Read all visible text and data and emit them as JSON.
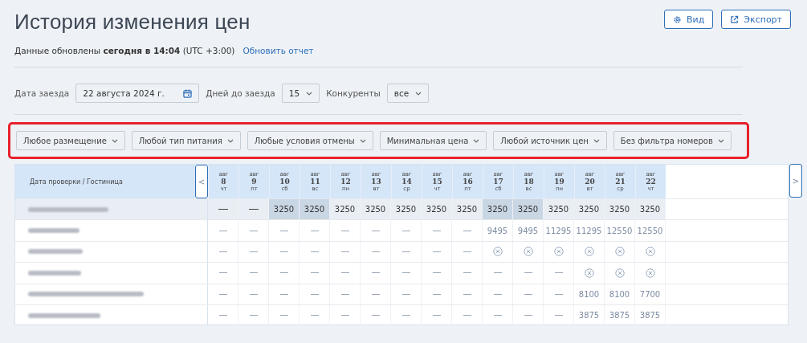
{
  "header": {
    "title": "История изменения цен",
    "buttons": [
      {
        "label": "Вид",
        "kind": "view"
      },
      {
        "label": "Экспорт",
        "kind": "export"
      }
    ]
  },
  "update_info": {
    "text": "Данные обновлены **сегодня в 14:04** (UTC +3:00)",
    "link": "Обновить отчет"
  },
  "controls": {
    "checkin": {
      "label": "Дата заезда",
      "value": "22 августа 2024 г."
    },
    "days": {
      "label": "Дней до заезда",
      "value": "15"
    },
    "competitors": {
      "label": "Конкуренты",
      "value": "все"
    }
  },
  "filters": {
    "highlighted": true,
    "items": [
      "Любое размещение",
      "Любой тип питания",
      "Любые условия отмены",
      "Минимальная цена",
      "Любой источник цен",
      "Без фильтра номеров"
    ]
  },
  "table": {
    "name_header": "Дата проверки / Гостиница",
    "prev": "<",
    "next": ">",
    "columns": [
      {
        "month": "авг",
        "day": "8",
        "weekday": "чт",
        "weekend": false
      },
      {
        "month": "авг",
        "day": "9",
        "weekday": "пт",
        "weekend": false
      },
      {
        "month": "авг",
        "day": "10",
        "weekday": "сб",
        "weekend": true
      },
      {
        "month": "авг",
        "day": "11",
        "weekday": "вс",
        "weekend": true
      },
      {
        "month": "авг",
        "day": "12",
        "weekday": "пн",
        "weekend": false
      },
      {
        "month": "авг",
        "day": "13",
        "weekday": "вт",
        "weekend": false
      },
      {
        "month": "авг",
        "day": "14",
        "weekday": "ср",
        "weekend": false
      },
      {
        "month": "авг",
        "day": "15",
        "weekday": "чт",
        "weekend": false
      },
      {
        "month": "авг",
        "day": "16",
        "weekday": "пт",
        "weekend": false
      },
      {
        "month": "авг",
        "day": "17",
        "weekday": "сб",
        "weekend": true
      },
      {
        "month": "авг",
        "day": "18",
        "weekday": "вс",
        "weekend": true
      },
      {
        "month": "авг",
        "day": "19",
        "weekday": "пн",
        "weekend": false
      },
      {
        "month": "авг",
        "day": "20",
        "weekday": "вт",
        "weekend": false
      },
      {
        "month": "авг",
        "day": "21",
        "weekday": "ср",
        "weekend": false
      },
      {
        "month": "авг",
        "day": "22",
        "weekday": "чт",
        "weekend": false
      }
    ],
    "rows": [
      {
        "highlighted": true,
        "cells": [
          {
            "kind": "dash"
          },
          {
            "kind": "dash"
          },
          {
            "kind": "price",
            "value": "3250"
          },
          {
            "kind": "price",
            "value": "3250"
          },
          {
            "kind": "price",
            "value": "3250"
          },
          {
            "kind": "price",
            "value": "3250"
          },
          {
            "kind": "price",
            "value": "3250"
          },
          {
            "kind": "price",
            "value": "3250"
          },
          {
            "kind": "price",
            "value": "3250"
          },
          {
            "kind": "price",
            "value": "3250"
          },
          {
            "kind": "price",
            "value": "3250"
          },
          {
            "kind": "price",
            "value": "3250"
          },
          {
            "kind": "price",
            "value": "3250"
          },
          {
            "kind": "price",
            "value": "3250"
          },
          {
            "kind": "price",
            "value": "3250"
          }
        ]
      },
      {
        "highlighted": false,
        "cells": [
          {
            "kind": "dash"
          },
          {
            "kind": "dash"
          },
          {
            "kind": "dash"
          },
          {
            "kind": "dash"
          },
          {
            "kind": "dash"
          },
          {
            "kind": "dash"
          },
          {
            "kind": "dash"
          },
          {
            "kind": "dash"
          },
          {
            "kind": "dash"
          },
          {
            "kind": "price",
            "value": "9495"
          },
          {
            "kind": "price",
            "value": "9495"
          },
          {
            "kind": "price",
            "value": "11295"
          },
          {
            "kind": "price",
            "value": "11295"
          },
          {
            "kind": "price",
            "value": "12550"
          },
          {
            "kind": "price",
            "value": "12550"
          }
        ]
      },
      {
        "highlighted": false,
        "cells": [
          {
            "kind": "dash"
          },
          {
            "kind": "dash"
          },
          {
            "kind": "dash"
          },
          {
            "kind": "dash"
          },
          {
            "kind": "dash"
          },
          {
            "kind": "dash"
          },
          {
            "kind": "dash"
          },
          {
            "kind": "dash"
          },
          {
            "kind": "dash"
          },
          {
            "kind": "unavailable"
          },
          {
            "kind": "unavailable"
          },
          {
            "kind": "unavailable"
          },
          {
            "kind": "unavailable"
          },
          {
            "kind": "unavailable"
          },
          {
            "kind": "unavailable"
          }
        ]
      },
      {
        "highlighted": false,
        "cells": [
          {
            "kind": "dash"
          },
          {
            "kind": "dash"
          },
          {
            "kind": "dash"
          },
          {
            "kind": "dash"
          },
          {
            "kind": "dash"
          },
          {
            "kind": "dash"
          },
          {
            "kind": "dash"
          },
          {
            "kind": "dash"
          },
          {
            "kind": "dash"
          },
          {
            "kind": "dash"
          },
          {
            "kind": "dash"
          },
          {
            "kind": "dash"
          },
          {
            "kind": "unavailable"
          },
          {
            "kind": "unavailable"
          },
          {
            "kind": "unavailable"
          }
        ]
      },
      {
        "highlighted": false,
        "cells": [
          {
            "kind": "dash"
          },
          {
            "kind": "dash"
          },
          {
            "kind": "dash"
          },
          {
            "kind": "dash"
          },
          {
            "kind": "dash"
          },
          {
            "kind": "dash"
          },
          {
            "kind": "dash"
          },
          {
            "kind": "dash"
          },
          {
            "kind": "dash"
          },
          {
            "kind": "dash"
          },
          {
            "kind": "dash"
          },
          {
            "kind": "dash"
          },
          {
            "kind": "price",
            "value": "8100"
          },
          {
            "kind": "price",
            "value": "8100"
          },
          {
            "kind": "price",
            "value": "7700"
          }
        ]
      },
      {
        "highlighted": false,
        "cells": [
          {
            "kind": "dash"
          },
          {
            "kind": "dash"
          },
          {
            "kind": "dash"
          },
          {
            "kind": "dash"
          },
          {
            "kind": "dash"
          },
          {
            "kind": "dash"
          },
          {
            "kind": "dash"
          },
          {
            "kind": "dash"
          },
          {
            "kind": "dash"
          },
          {
            "kind": "dash"
          },
          {
            "kind": "dash"
          },
          {
            "kind": "dash"
          },
          {
            "kind": "price",
            "value": "3875"
          },
          {
            "kind": "price",
            "value": "3875"
          },
          {
            "kind": "price",
            "value": "3875"
          }
        ]
      }
    ]
  }
}
